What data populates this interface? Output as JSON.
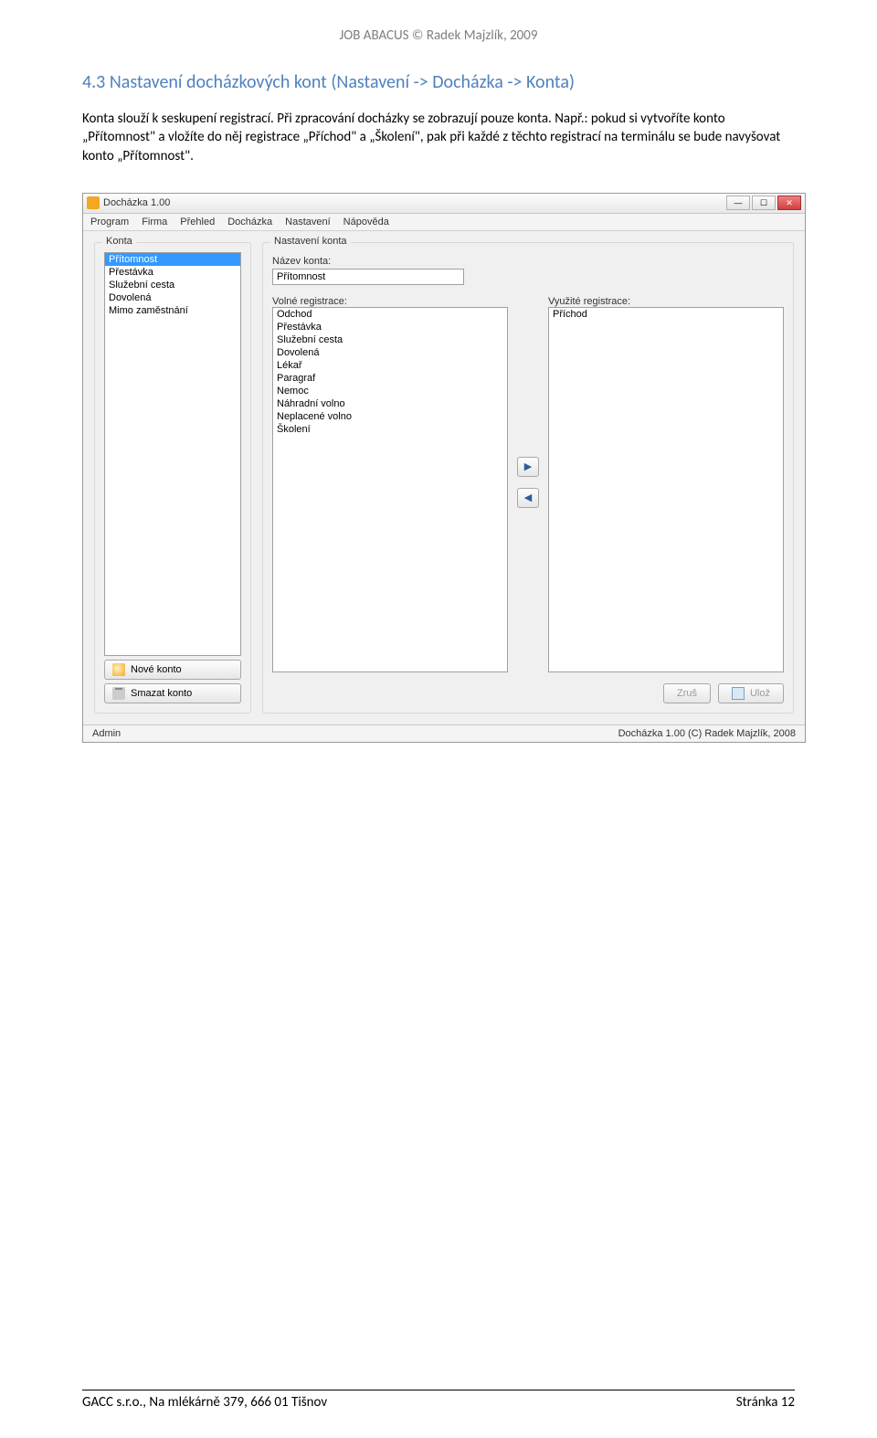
{
  "doc": {
    "header": "JOB ABACUS © Radek Majzlík, 2009",
    "section_title": "4.3 Nastavení docházkových kont (Nastavení -> Docházka -> Konta)",
    "body": "Konta slouží k seskupení registrací. Při zpracování docházky se zobrazují pouze konta. Např.: pokud si vytvoříte konto „Přítomnost\" a vložíte do něj registrace „Příchod\" a „Školení\", pak při každé z těchto registrací na terminálu se bude navyšovat konto „Přítomnost\".",
    "footer_left": "GACC s.r.o., Na mlékárně 379, 666 01 Tišnov",
    "footer_right": "Stránka 12"
  },
  "window": {
    "title": "Docházka 1.00",
    "menu": [
      "Program",
      "Firma",
      "Přehled",
      "Docházka",
      "Nastavení",
      "Nápověda"
    ],
    "left": {
      "group_label": "Konta",
      "items": [
        "Přítomnost",
        "Přestávka",
        "Služební cesta",
        "Dovolená",
        "Mimo zaměstnání"
      ],
      "selected_index": 0,
      "btn_new": "Nové konto",
      "btn_delete": "Smazat konto"
    },
    "right": {
      "group_label": "Nastavení konta",
      "name_label": "Název konta:",
      "name_value": "Přítomnost",
      "free_label": "Volné registrace:",
      "free_items": [
        "Odchod",
        "Přestávka",
        "Služební cesta",
        "Dovolená",
        "Lékař",
        "Paragraf",
        "Nemoc",
        "Náhradní volno",
        "Neplacené volno",
        "Školení"
      ],
      "used_label": "Využité registrace:",
      "used_items": [
        "Příchod"
      ],
      "btn_cancel": "Zruš",
      "btn_save": "Ulož"
    },
    "status_left": "Admin",
    "status_right": "Docházka 1.00 (C) Radek Majzlík, 2008"
  }
}
